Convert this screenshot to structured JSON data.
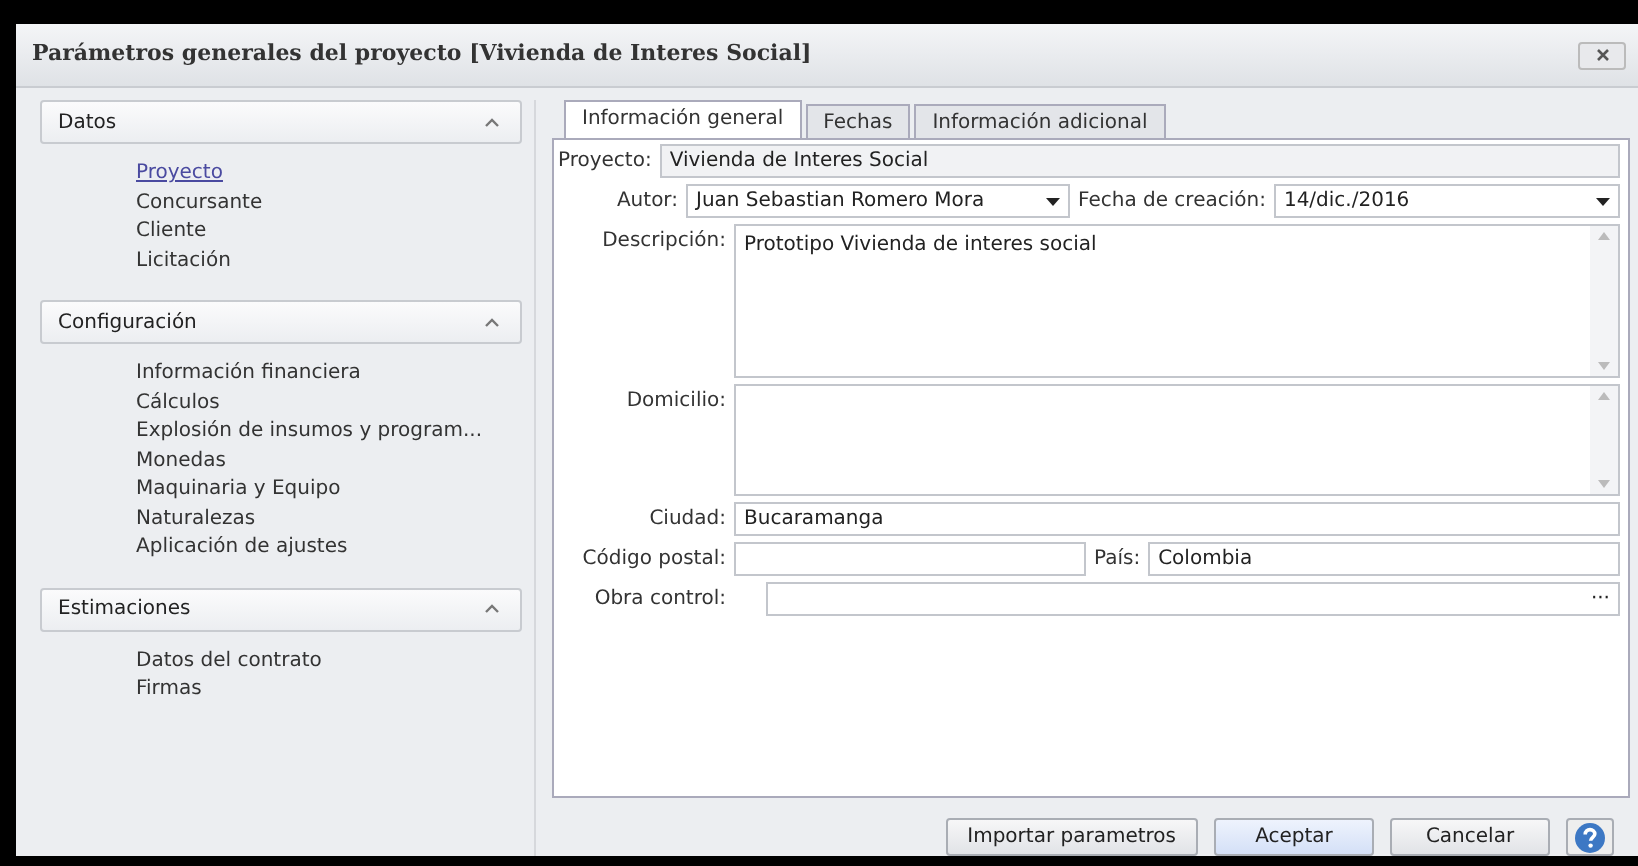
{
  "window": {
    "title": "Parámetros generales del proyecto [Vivienda de Interes Social]"
  },
  "sidebar": {
    "sections": [
      {
        "title": "Datos",
        "expanded": true,
        "items": [
          {
            "label": "Proyecto",
            "selected": true
          },
          {
            "label": "Concursante",
            "selected": false
          },
          {
            "label": "Cliente",
            "selected": false
          },
          {
            "label": "Licitación",
            "selected": false
          }
        ]
      },
      {
        "title": "Configuración",
        "expanded": true,
        "items": [
          {
            "label": "Información financiera",
            "selected": false
          },
          {
            "label": "Cálculos",
            "selected": false
          },
          {
            "label": "Explosión de insumos y program...",
            "selected": false
          },
          {
            "label": "Monedas",
            "selected": false
          },
          {
            "label": "Maquinaria y Equipo",
            "selected": false
          },
          {
            "label": "Naturalezas",
            "selected": false
          },
          {
            "label": "Aplicación de ajustes",
            "selected": false
          }
        ]
      },
      {
        "title": "Estimaciones",
        "expanded": true,
        "items": [
          {
            "label": "Datos del contrato",
            "selected": false
          },
          {
            "label": "Firmas",
            "selected": false
          }
        ]
      }
    ]
  },
  "tabs": [
    {
      "label": "Información general",
      "selected": true
    },
    {
      "label": "Fechas",
      "selected": false
    },
    {
      "label": "Información adicional",
      "selected": false
    }
  ],
  "form": {
    "proyecto": {
      "label": "Proyecto:",
      "value": "Vivienda de Interes Social",
      "disabled": true
    },
    "autor": {
      "label": "Autor:",
      "value": "Juan Sebastian Romero Mora"
    },
    "fecha": {
      "label": "Fecha de creación:",
      "value": "14/dic./2016"
    },
    "descripcion": {
      "label": "Descripción:",
      "value": "Prototipo Vivienda de interes social"
    },
    "domicilio": {
      "label": "Domicilio:"
    },
    "ciudad": {
      "label": "Ciudad:",
      "value": "Bucaramanga"
    },
    "codigo_postal": {
      "label": "Código postal:"
    },
    "pais": {
      "label": "País:",
      "value": "Colombia"
    },
    "obra_control": {
      "label": "Obra control:",
      "button": "···"
    }
  },
  "buttons": [
    {
      "label": "Importar parametros",
      "default": false
    },
    {
      "label": "Aceptar",
      "default": true
    },
    {
      "label": "Cancelar",
      "default": false
    }
  ]
}
